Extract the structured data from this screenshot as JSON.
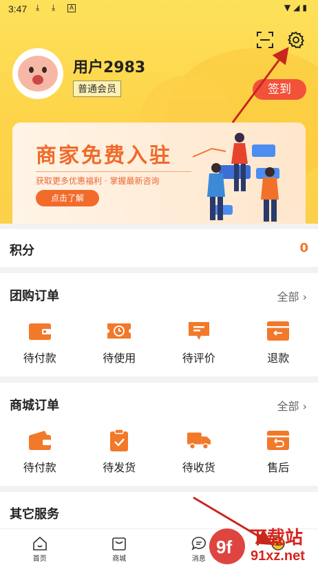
{
  "status_bar": {
    "time": "3:47"
  },
  "header": {
    "username": "用户2983",
    "member_level": "普通会员",
    "signin_label": "签到"
  },
  "banner": {
    "title": "商家免费入驻",
    "subtitle": "获取更多优惠福利 · 掌握最新咨询",
    "button_label": "点击了解"
  },
  "points": {
    "label": "积分",
    "value": "0"
  },
  "group_orders": {
    "title": "团购订单",
    "all_label": "全部",
    "items": [
      {
        "label": "待付款"
      },
      {
        "label": "待使用"
      },
      {
        "label": "待评价"
      },
      {
        "label": "退款"
      }
    ]
  },
  "mall_orders": {
    "title": "商城订单",
    "all_label": "全部",
    "items": [
      {
        "label": "待付款"
      },
      {
        "label": "待发货"
      },
      {
        "label": "待收货"
      },
      {
        "label": "售后"
      }
    ]
  },
  "other_services": {
    "title": "其它服务"
  },
  "tabbar": {
    "items": [
      {
        "label": "首页"
      },
      {
        "label": "商城"
      },
      {
        "label": "消息"
      },
      {
        "label": ""
      }
    ]
  },
  "watermark": {
    "text": "下载站",
    "site": "91xz.net",
    "logo_text": "9f"
  },
  "colors": {
    "accent": "#f0762a",
    "signin": "#f2513a",
    "header_bg": "#fdd449",
    "annotation_arrow": "#c8261e"
  }
}
